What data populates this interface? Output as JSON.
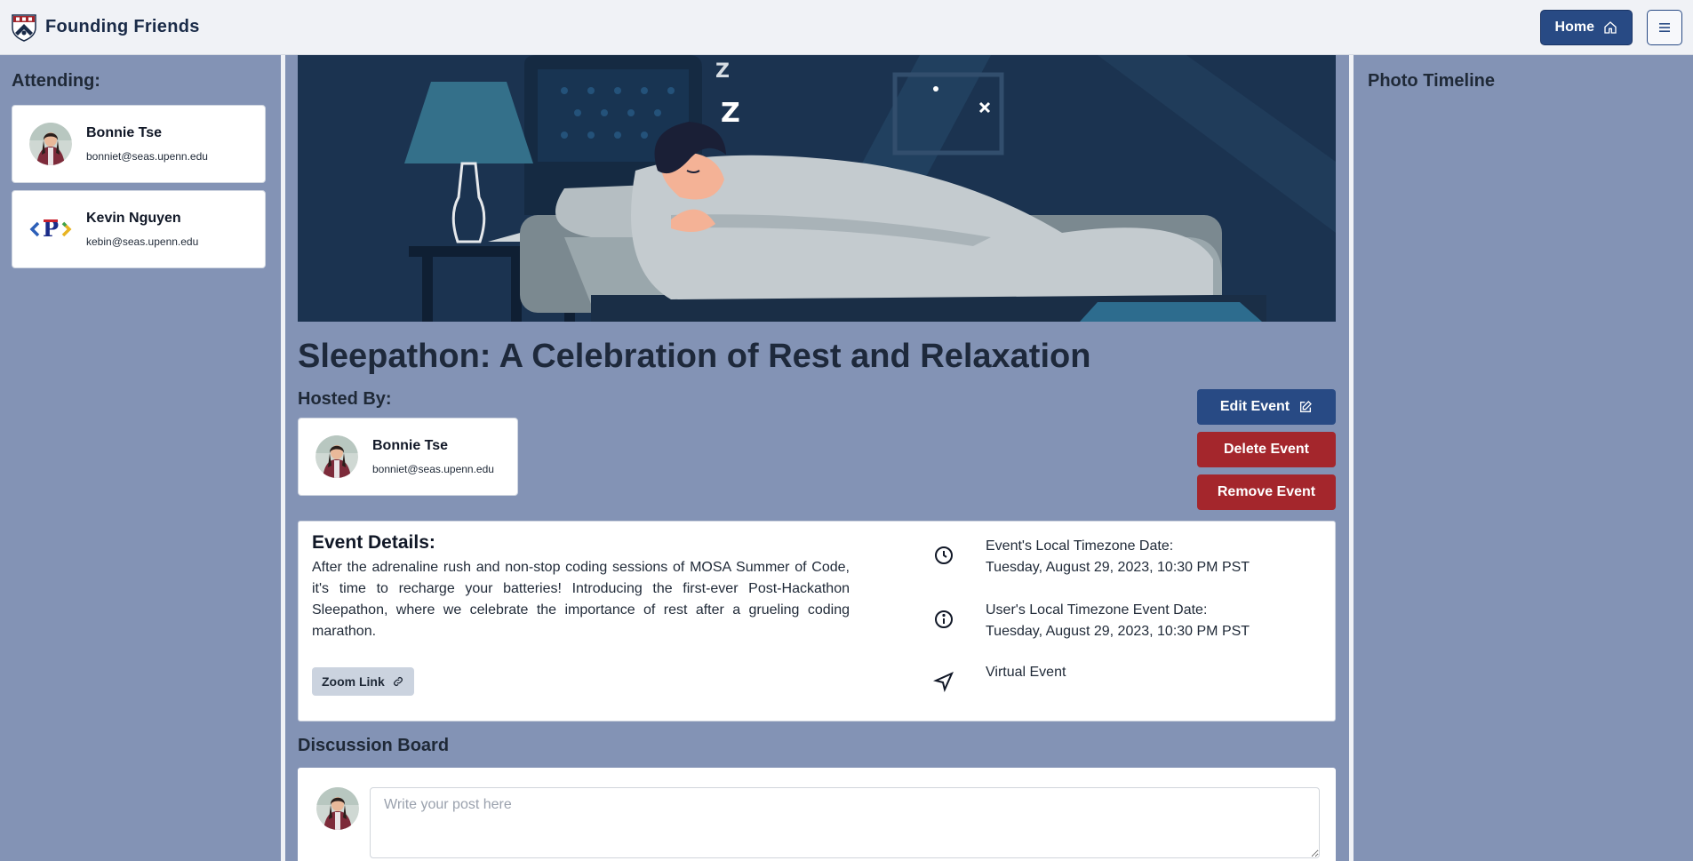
{
  "header": {
    "app_name": "Founding Friends",
    "home_label": "Home",
    "colors": {
      "primary": "#284a84",
      "danger": "#a4262c",
      "page_bg": "#8393b5"
    }
  },
  "attending": {
    "title": "Attending:",
    "people": [
      {
        "name": "Bonnie Tse",
        "email": "bonniet@seas.upenn.edu",
        "avatar": "photo-avatar"
      },
      {
        "name": "Kevin Nguyen",
        "email": "kebin@seas.upenn.edu",
        "avatar": "penn-p-logo"
      }
    ]
  },
  "event": {
    "title": "Sleepathon: A Celebration of Rest and Relaxation",
    "hosted_by_label": "Hosted By:",
    "host": {
      "name": "Bonnie Tse",
      "email": "bonniet@seas.upenn.edu"
    },
    "actions": {
      "edit": "Edit Event",
      "delete": "Delete Event",
      "remove": "Remove Event"
    },
    "details": {
      "heading": "Event Details:",
      "description": "After the adrenaline rush and non-stop coding sessions of MOSA Summer of Code, it's time to recharge your batteries! Introducing the first-ever Post-Hackathon Sleepathon, where we celebrate the importance of rest after a grueling coding marathon.",
      "zoom_label": "Zoom Link",
      "local_date_label": "Event's Local Timezone Date:",
      "local_date": "Tuesday, August 29, 2023, 10:30 PM PST",
      "user_date_label": "User's Local Timezone Event Date:",
      "user_date": "Tuesday, August 29, 2023, 10:30 PM PST",
      "location": "Virtual Event"
    }
  },
  "discussion": {
    "title": "Discussion Board",
    "placeholder": "Write your post here"
  },
  "photo_timeline": {
    "title": "Photo Timeline"
  }
}
